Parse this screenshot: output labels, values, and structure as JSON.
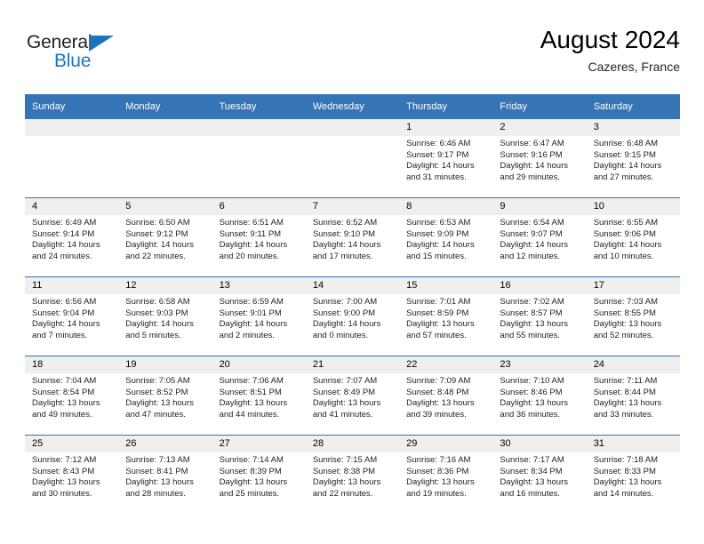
{
  "brand": {
    "name_part1": "General",
    "name_part2": "Blue",
    "triangle_color": "#1b75bb",
    "text_color": "#231f20"
  },
  "header": {
    "month_title": "August 2024",
    "location": "Cazeres, France"
  },
  "theme": {
    "header_blue": "#3574b5",
    "daynum_band": "#efefef",
    "text": "#231f20"
  },
  "calendar": {
    "weekday_headers": [
      "Sunday",
      "Monday",
      "Tuesday",
      "Wednesday",
      "Thursday",
      "Friday",
      "Saturday"
    ],
    "labels": {
      "sunrise": "Sunrise:",
      "sunset": "Sunset:",
      "daylight": "Daylight:"
    },
    "weeks": [
      [
        {
          "day": "",
          "l1": "",
          "l2": "",
          "l3": "",
          "l4": ""
        },
        {
          "day": "",
          "l1": "",
          "l2": "",
          "l3": "",
          "l4": ""
        },
        {
          "day": "",
          "l1": "",
          "l2": "",
          "l3": "",
          "l4": ""
        },
        {
          "day": "",
          "l1": "",
          "l2": "",
          "l3": "",
          "l4": ""
        },
        {
          "day": "1",
          "l1": "Sunrise: 6:46 AM",
          "l2": "Sunset: 9:17 PM",
          "l3": "Daylight: 14 hours",
          "l4": "and 31 minutes."
        },
        {
          "day": "2",
          "l1": "Sunrise: 6:47 AM",
          "l2": "Sunset: 9:16 PM",
          "l3": "Daylight: 14 hours",
          "l4": "and 29 minutes."
        },
        {
          "day": "3",
          "l1": "Sunrise: 6:48 AM",
          "l2": "Sunset: 9:15 PM",
          "l3": "Daylight: 14 hours",
          "l4": "and 27 minutes."
        }
      ],
      [
        {
          "day": "4",
          "l1": "Sunrise: 6:49 AM",
          "l2": "Sunset: 9:14 PM",
          "l3": "Daylight: 14 hours",
          "l4": "and 24 minutes."
        },
        {
          "day": "5",
          "l1": "Sunrise: 6:50 AM",
          "l2": "Sunset: 9:12 PM",
          "l3": "Daylight: 14 hours",
          "l4": "and 22 minutes."
        },
        {
          "day": "6",
          "l1": "Sunrise: 6:51 AM",
          "l2": "Sunset: 9:11 PM",
          "l3": "Daylight: 14 hours",
          "l4": "and 20 minutes."
        },
        {
          "day": "7",
          "l1": "Sunrise: 6:52 AM",
          "l2": "Sunset: 9:10 PM",
          "l3": "Daylight: 14 hours",
          "l4": "and 17 minutes."
        },
        {
          "day": "8",
          "l1": "Sunrise: 6:53 AM",
          "l2": "Sunset: 9:09 PM",
          "l3": "Daylight: 14 hours",
          "l4": "and 15 minutes."
        },
        {
          "day": "9",
          "l1": "Sunrise: 6:54 AM",
          "l2": "Sunset: 9:07 PM",
          "l3": "Daylight: 14 hours",
          "l4": "and 12 minutes."
        },
        {
          "day": "10",
          "l1": "Sunrise: 6:55 AM",
          "l2": "Sunset: 9:06 PM",
          "l3": "Daylight: 14 hours",
          "l4": "and 10 minutes."
        }
      ],
      [
        {
          "day": "11",
          "l1": "Sunrise: 6:56 AM",
          "l2": "Sunset: 9:04 PM",
          "l3": "Daylight: 14 hours",
          "l4": "and 7 minutes."
        },
        {
          "day": "12",
          "l1": "Sunrise: 6:58 AM",
          "l2": "Sunset: 9:03 PM",
          "l3": "Daylight: 14 hours",
          "l4": "and 5 minutes."
        },
        {
          "day": "13",
          "l1": "Sunrise: 6:59 AM",
          "l2": "Sunset: 9:01 PM",
          "l3": "Daylight: 14 hours",
          "l4": "and 2 minutes."
        },
        {
          "day": "14",
          "l1": "Sunrise: 7:00 AM",
          "l2": "Sunset: 9:00 PM",
          "l3": "Daylight: 14 hours",
          "l4": "and 0 minutes."
        },
        {
          "day": "15",
          "l1": "Sunrise: 7:01 AM",
          "l2": "Sunset: 8:59 PM",
          "l3": "Daylight: 13 hours",
          "l4": "and 57 minutes."
        },
        {
          "day": "16",
          "l1": "Sunrise: 7:02 AM",
          "l2": "Sunset: 8:57 PM",
          "l3": "Daylight: 13 hours",
          "l4": "and 55 minutes."
        },
        {
          "day": "17",
          "l1": "Sunrise: 7:03 AM",
          "l2": "Sunset: 8:55 PM",
          "l3": "Daylight: 13 hours",
          "l4": "and 52 minutes."
        }
      ],
      [
        {
          "day": "18",
          "l1": "Sunrise: 7:04 AM",
          "l2": "Sunset: 8:54 PM",
          "l3": "Daylight: 13 hours",
          "l4": "and 49 minutes."
        },
        {
          "day": "19",
          "l1": "Sunrise: 7:05 AM",
          "l2": "Sunset: 8:52 PM",
          "l3": "Daylight: 13 hours",
          "l4": "and 47 minutes."
        },
        {
          "day": "20",
          "l1": "Sunrise: 7:06 AM",
          "l2": "Sunset: 8:51 PM",
          "l3": "Daylight: 13 hours",
          "l4": "and 44 minutes."
        },
        {
          "day": "21",
          "l1": "Sunrise: 7:07 AM",
          "l2": "Sunset: 8:49 PM",
          "l3": "Daylight: 13 hours",
          "l4": "and 41 minutes."
        },
        {
          "day": "22",
          "l1": "Sunrise: 7:09 AM",
          "l2": "Sunset: 8:48 PM",
          "l3": "Daylight: 13 hours",
          "l4": "and 39 minutes."
        },
        {
          "day": "23",
          "l1": "Sunrise: 7:10 AM",
          "l2": "Sunset: 8:46 PM",
          "l3": "Daylight: 13 hours",
          "l4": "and 36 minutes."
        },
        {
          "day": "24",
          "l1": "Sunrise: 7:11 AM",
          "l2": "Sunset: 8:44 PM",
          "l3": "Daylight: 13 hours",
          "l4": "and 33 minutes."
        }
      ],
      [
        {
          "day": "25",
          "l1": "Sunrise: 7:12 AM",
          "l2": "Sunset: 8:43 PM",
          "l3": "Daylight: 13 hours",
          "l4": "and 30 minutes."
        },
        {
          "day": "26",
          "l1": "Sunrise: 7:13 AM",
          "l2": "Sunset: 8:41 PM",
          "l3": "Daylight: 13 hours",
          "l4": "and 28 minutes."
        },
        {
          "day": "27",
          "l1": "Sunrise: 7:14 AM",
          "l2": "Sunset: 8:39 PM",
          "l3": "Daylight: 13 hours",
          "l4": "and 25 minutes."
        },
        {
          "day": "28",
          "l1": "Sunrise: 7:15 AM",
          "l2": "Sunset: 8:38 PM",
          "l3": "Daylight: 13 hours",
          "l4": "and 22 minutes."
        },
        {
          "day": "29",
          "l1": "Sunrise: 7:16 AM",
          "l2": "Sunset: 8:36 PM",
          "l3": "Daylight: 13 hours",
          "l4": "and 19 minutes."
        },
        {
          "day": "30",
          "l1": "Sunrise: 7:17 AM",
          "l2": "Sunset: 8:34 PM",
          "l3": "Daylight: 13 hours",
          "l4": "and 16 minutes."
        },
        {
          "day": "31",
          "l1": "Sunrise: 7:18 AM",
          "l2": "Sunset: 8:33 PM",
          "l3": "Daylight: 13 hours",
          "l4": "and 14 minutes."
        }
      ]
    ]
  }
}
